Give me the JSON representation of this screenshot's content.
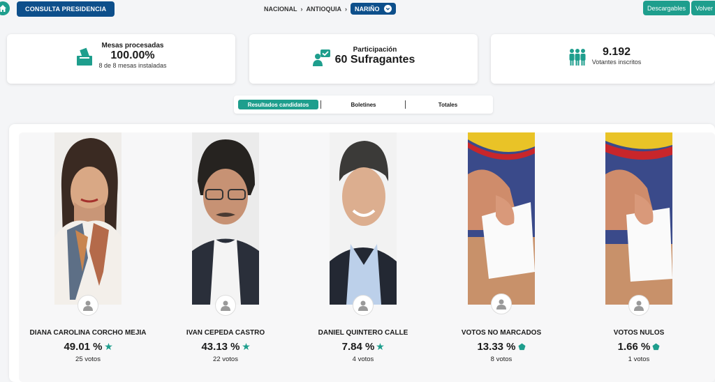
{
  "header": {
    "consulta_label": "CONSULTA PRESIDENCIA",
    "breadcrumbs": [
      "NACIONAL",
      "ANTIOQUIA",
      "NARIÑO"
    ],
    "descargables_label": "Descargables",
    "volver_label": "Volver"
  },
  "stats": {
    "mesas": {
      "title": "Mesas procesadas",
      "value": "100.00%",
      "sub": "8 de 8 mesas instaladas"
    },
    "participacion": {
      "title": "Participación",
      "value": "60 Sufragantes"
    },
    "votantes": {
      "value": "9.192",
      "sub": "Votantes inscritos"
    }
  },
  "tabs": [
    "Resultados candidatos",
    "Boletines",
    "Totales"
  ],
  "candidates": [
    {
      "name": "DIANA CAROLINA CORCHO MEJIA",
      "pct": "49.01 %",
      "votes": "25 votos"
    },
    {
      "name": "IVAN CEPEDA CASTRO",
      "pct": "43.13 %",
      "votes": "22 votos"
    },
    {
      "name": "DANIEL QUINTERO CALLE",
      "pct": "7.84 %",
      "votes": "4 votos"
    },
    {
      "name": "VOTOS NO MARCADOS",
      "pct": "13.33 %",
      "votes": "8 votos"
    },
    {
      "name": "VOTOS NULOS",
      "pct": "1.66 %",
      "votes": "1 votos"
    }
  ],
  "colors": {
    "teal": "#1e9e8d",
    "navy": "#0d4f8b"
  }
}
